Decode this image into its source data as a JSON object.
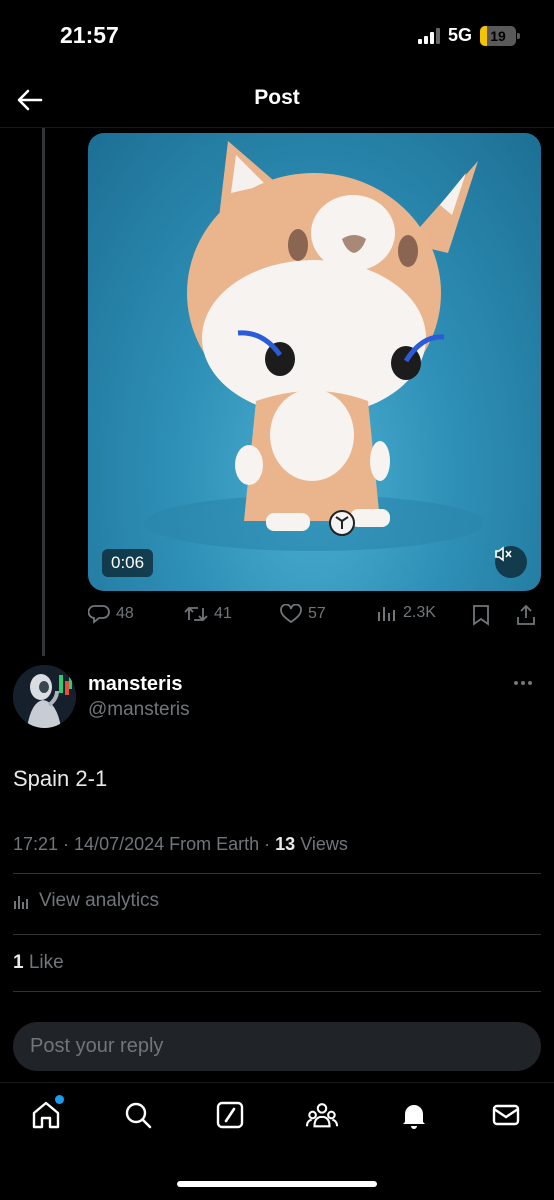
{
  "status_bar": {
    "time": "21:57",
    "network": "5G",
    "battery": "19",
    "battery_level": 0.19
  },
  "header": {
    "title": "Post"
  },
  "video": {
    "duration": "0:06"
  },
  "actions": {
    "replies": "48",
    "reposts": "41",
    "likes": "57",
    "views": "2.3K"
  },
  "author": {
    "name": "mansteris",
    "handle": "@mansteris"
  },
  "post": {
    "text": "Spain 2-1",
    "timestamp": "17:21 · 14/07/2024 From Earth · ",
    "views_count": "13",
    "views_label": " Views"
  },
  "analytics": {
    "label": "View analytics"
  },
  "likes_row": {
    "count": "1",
    "label": " Like"
  },
  "reply": {
    "placeholder": "Post your reply"
  },
  "nav": {
    "items": [
      "home-icon",
      "search-icon",
      "grok-icon",
      "communities-icon",
      "notifications-icon",
      "messages-icon"
    ],
    "accent": "#1d9bf0"
  }
}
